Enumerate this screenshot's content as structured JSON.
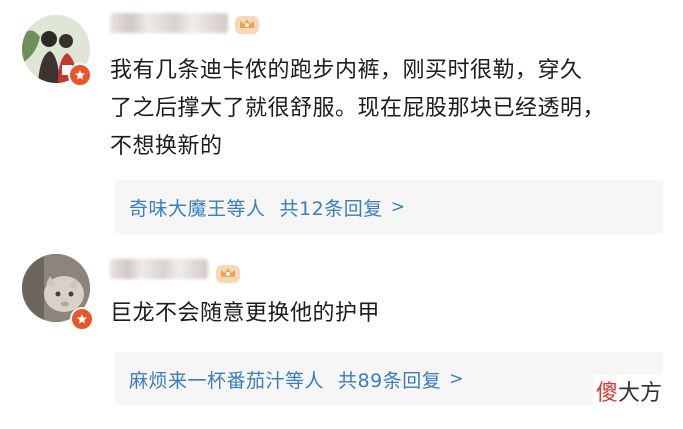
{
  "comments": [
    {
      "text_lines": [
        "我有几条迪卡侬的跑步内裤，刚买时很勒，穿久",
        "了之后撑大了就很舒服。现在屁股那块已经透明，",
        "不想换新的"
      ],
      "reply_summary": {
        "names": "奇味大魔王等人",
        "count": "共12条回复",
        "chevron": ">"
      }
    },
    {
      "text_lines": [
        "巨龙不会随意更换他的护甲"
      ],
      "reply_summary": {
        "names": "麻烦来一杯番茄汁等人",
        "count": "共89条回复",
        "chevron": ">"
      }
    }
  ],
  "watermark": {
    "first": "傻",
    "rest": "大方"
  },
  "colors": {
    "link": "#3a7dc1",
    "badge": "#e8562a",
    "reply_bg": "#f6f6f6"
  }
}
